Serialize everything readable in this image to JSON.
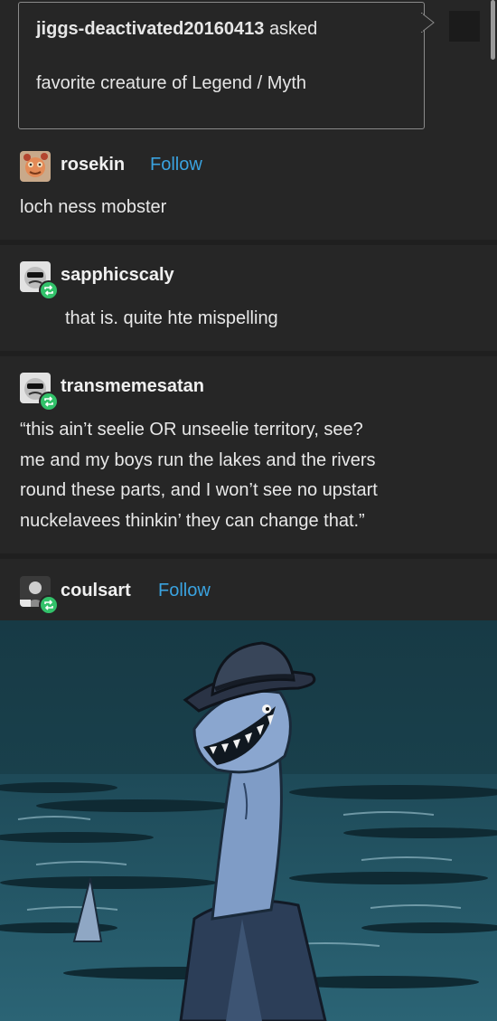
{
  "ask": {
    "asker": "jiggs-deactivated20160413",
    "asked_label": "asked",
    "question": "favorite creature of Legend / Myth"
  },
  "posts": [
    {
      "username": "rosekin",
      "follow": "Follow",
      "text": "loch ness mobster"
    },
    {
      "username": "sapphicscaly",
      "text": "that is. quite hte mispelling"
    },
    {
      "username": "transmemesatan",
      "lines": [
        "“this ain’t seelie OR unseelie territory, see?",
        "me and my boys run the lakes and the rivers",
        "round these parts, and I won’t see no upstart",
        "nuckelavees thinkin’ they can change that.”"
      ]
    },
    {
      "username": "coulsart",
      "follow": "Follow"
    }
  ],
  "colors": {
    "background": "#262626",
    "follow_link": "#3aa3e0",
    "reblog_badge": "#32c26a"
  },
  "image": {
    "content": "illustration of a loch ness monster in a fedora and suit, grinning, in dark water"
  }
}
